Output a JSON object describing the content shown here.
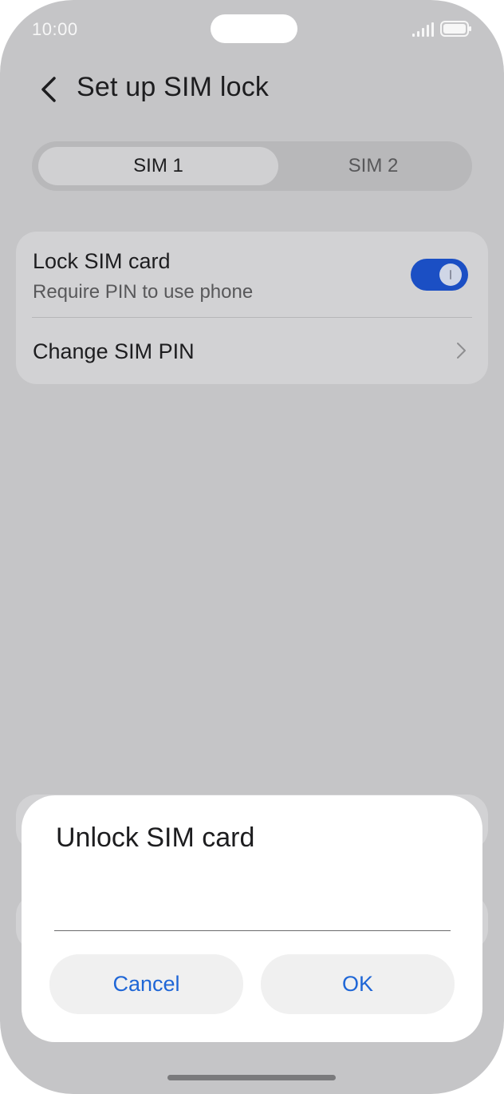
{
  "status_bar": {
    "time": "10:00"
  },
  "header": {
    "title": "Set up SIM lock"
  },
  "sim_tabs": [
    {
      "label": "SIM 1",
      "selected": true
    },
    {
      "label": "SIM 2",
      "selected": false
    }
  ],
  "settings": {
    "lock_sim": {
      "title": "Lock SIM card",
      "subtitle": "Require PIN to use phone",
      "enabled": true
    },
    "change_pin": {
      "title": "Change SIM PIN"
    }
  },
  "dialog": {
    "title": "Unlock SIM card",
    "pin_value": "",
    "cancel_label": "Cancel",
    "ok_label": "OK"
  },
  "colors": {
    "accent": "#1b4fc4",
    "dialog_button_text": "#1f66d6",
    "overlay_background": "#c5c5c7"
  },
  "icons": [
    "back-arrow-icon",
    "chevron-right-icon",
    "signal-icon",
    "battery-icon"
  ]
}
